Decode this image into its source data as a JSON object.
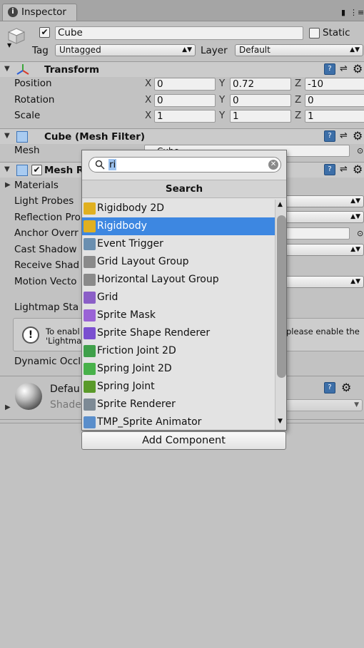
{
  "tab": {
    "title": "Inspector",
    "lock": "🔒",
    "menu": "⋮≡"
  },
  "object": {
    "name": "Cube",
    "static_label": "Static",
    "tag_label": "Tag",
    "tag_value": "Untagged",
    "layer_label": "Layer",
    "layer_value": "Default"
  },
  "transform": {
    "title": "Transform",
    "rows": [
      {
        "label": "Position",
        "x": "0",
        "y": "0.72",
        "z": "-10"
      },
      {
        "label": "Rotation",
        "x": "0",
        "y": "0",
        "z": "0"
      },
      {
        "label": "Scale",
        "x": "1",
        "y": "1",
        "z": "1"
      }
    ],
    "axis": {
      "x": "X",
      "y": "Y",
      "z": "Z"
    }
  },
  "mesh_filter": {
    "title": "Cube (Mesh Filter)",
    "mesh_label": "Mesh",
    "mesh_value": "Cube"
  },
  "mesh_renderer": {
    "title": "Mesh R",
    "rows": [
      "Materials",
      "Light Probes",
      "Reflection Pro",
      "Anchor Overr",
      "Cast Shadow",
      "Receive Shad",
      "Motion Vecto"
    ],
    "lightmap_label": "Lightmap Sta",
    "info_left_1": "To enabl",
    "info_left_2": "'Lightma",
    "info_right": "please enable the",
    "dynamic_occl": "Dynamic Occl"
  },
  "material": {
    "name": "Defau",
    "shader_label": "Shade"
  },
  "popup": {
    "search_value": "ri",
    "header": "Search",
    "items": [
      {
        "label": "Rigidbody 2D",
        "icon": "rigidbody2d-icon",
        "color": "#e0b020"
      },
      {
        "label": "Rigidbody",
        "icon": "rigidbody-icon",
        "color": "#e0b020",
        "selected": true
      },
      {
        "label": "Event Trigger",
        "icon": "event-trigger-icon",
        "color": "#6a8fb0"
      },
      {
        "label": "Grid Layout Group",
        "icon": "grid-layout-icon",
        "color": "#8a8a8a"
      },
      {
        "label": "Horizontal Layout Group",
        "icon": "horizontal-layout-icon",
        "color": "#8a8a8a"
      },
      {
        "label": "Grid",
        "icon": "grid-icon",
        "color": "#8b5fc7"
      },
      {
        "label": "Sprite Mask",
        "icon": "sprite-mask-icon",
        "color": "#9a63d6"
      },
      {
        "label": "Sprite Shape Renderer",
        "icon": "sprite-shape-icon",
        "color": "#7a4fd0"
      },
      {
        "label": "Friction Joint 2D",
        "icon": "friction-joint-icon",
        "color": "#3fa04a"
      },
      {
        "label": "Spring Joint 2D",
        "icon": "spring-joint2d-icon",
        "color": "#48b14a"
      },
      {
        "label": "Spring Joint",
        "icon": "spring-joint-icon",
        "color": "#5a9a2a"
      },
      {
        "label": "Sprite Renderer",
        "icon": "sprite-renderer-icon",
        "color": "#7d8a95"
      },
      {
        "label": "TMP_Sprite Animator",
        "icon": "script-icon",
        "color": "#5a8ecb"
      }
    ]
  },
  "add_component": "Add Component",
  "colors": {
    "selection": "#3d87e1",
    "panel": "#c2c2c2",
    "header": "#cbcbcb"
  }
}
